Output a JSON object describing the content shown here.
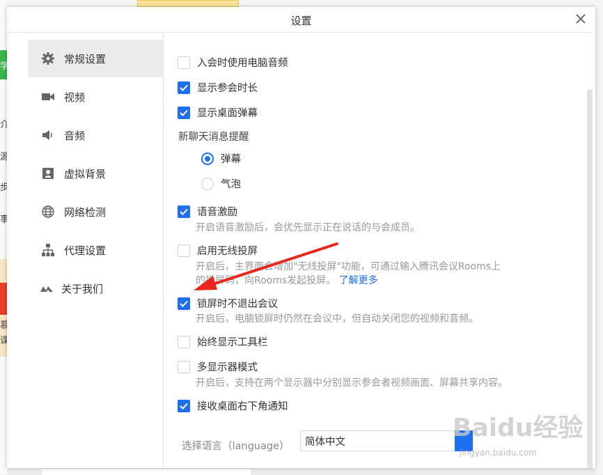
{
  "dialog": {
    "title": "设置"
  },
  "sidebar": {
    "items": [
      {
        "label": "常规设置",
        "icon": "gear-icon",
        "active": true
      },
      {
        "label": "视频",
        "icon": "video-icon"
      },
      {
        "label": "音频",
        "icon": "speaker-icon"
      },
      {
        "label": "虚拟背景",
        "icon": "portrait-icon"
      },
      {
        "label": "网络检测",
        "icon": "globe-icon"
      },
      {
        "label": "代理设置",
        "icon": "network-icon"
      },
      {
        "label": "关于我们",
        "icon": "logo-icon"
      }
    ]
  },
  "general": {
    "use_pc_audio": {
      "label": "入会时使用电脑音频",
      "checked": false
    },
    "show_duration": {
      "label": "显示参会时长",
      "checked": true
    },
    "show_danmaku": {
      "label": "显示桌面弹幕",
      "checked": true
    },
    "chat_reminder": {
      "label": "新聊天消息提醒",
      "options": [
        {
          "label": "弹幕",
          "selected": true
        },
        {
          "label": "气泡",
          "selected": false
        }
      ]
    },
    "voice_excite": {
      "label": "语音激励",
      "checked": true,
      "desc": "开启语音激励后，会优先显示正在说话的与会成员。"
    },
    "wireless_cast": {
      "label": "启用无线投屏",
      "checked": false,
      "desc_line1": "开启后，主界面会增加\"无线投屏\"功能，可通过输入腾讯会议Rooms上",
      "desc_line2": "的投屏码，向Rooms发起投屏。",
      "link": "了解更多"
    },
    "lock_screen": {
      "label": "锁屏时不退出会议",
      "checked": true,
      "desc": "开启后，电脑锁屏时仍然在会议中，但自动关闭您的视频和音频。"
    },
    "always_toolbar": {
      "label": "始终显示工具栏",
      "checked": false
    },
    "multi_monitor": {
      "label": "多显示器模式",
      "checked": false,
      "desc": "开启后，支持在两个显示器中分别显示参会者视频画面、屏幕共享内容。"
    },
    "corner_notify": {
      "label": "接收桌面右下角通知",
      "checked": true
    },
    "language": {
      "label": "选择语言（language）",
      "value": "简体中文"
    }
  },
  "background": {
    "left_text": [
      "学",
      "介",
      "源",
      "步",
      "事",
      "慕",
      "课"
    ],
    "watermark": "Baidu经验",
    "watermark_sub": "jingyan.baidu.com"
  },
  "colors": {
    "accent": "#1e6ff0",
    "annotation_arrow": "#e8271f"
  }
}
